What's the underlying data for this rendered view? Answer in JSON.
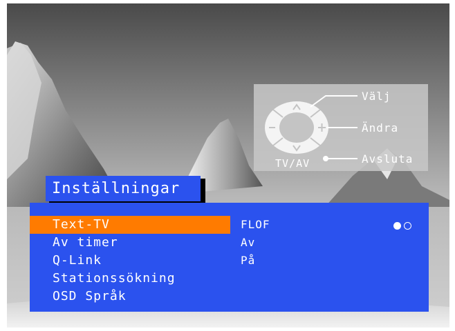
{
  "remote_help": {
    "select_label": "Välj",
    "change_label": "Ändra",
    "exit_label": "Avsluta",
    "tvav_label": "TV/AV"
  },
  "menu": {
    "title": "Inställningar",
    "items": [
      {
        "label": "Text-TV",
        "selected": true
      },
      {
        "label": "Av timer",
        "selected": false
      },
      {
        "label": "Q-Link",
        "selected": false
      },
      {
        "label": "Stationssökning",
        "selected": false
      },
      {
        "label": "OSD Språk",
        "selected": false
      }
    ],
    "values": [
      "FLOF",
      "Av",
      "På"
    ],
    "page_indicator": {
      "current": 1,
      "total": 2
    }
  },
  "colors": {
    "menu_blue": "#2b52ee",
    "highlight_orange": "#ff7b00",
    "text": "#ffffff"
  },
  "icons": [
    "up-arrow-icon",
    "down-arrow-icon",
    "minus-icon",
    "plus-icon"
  ]
}
